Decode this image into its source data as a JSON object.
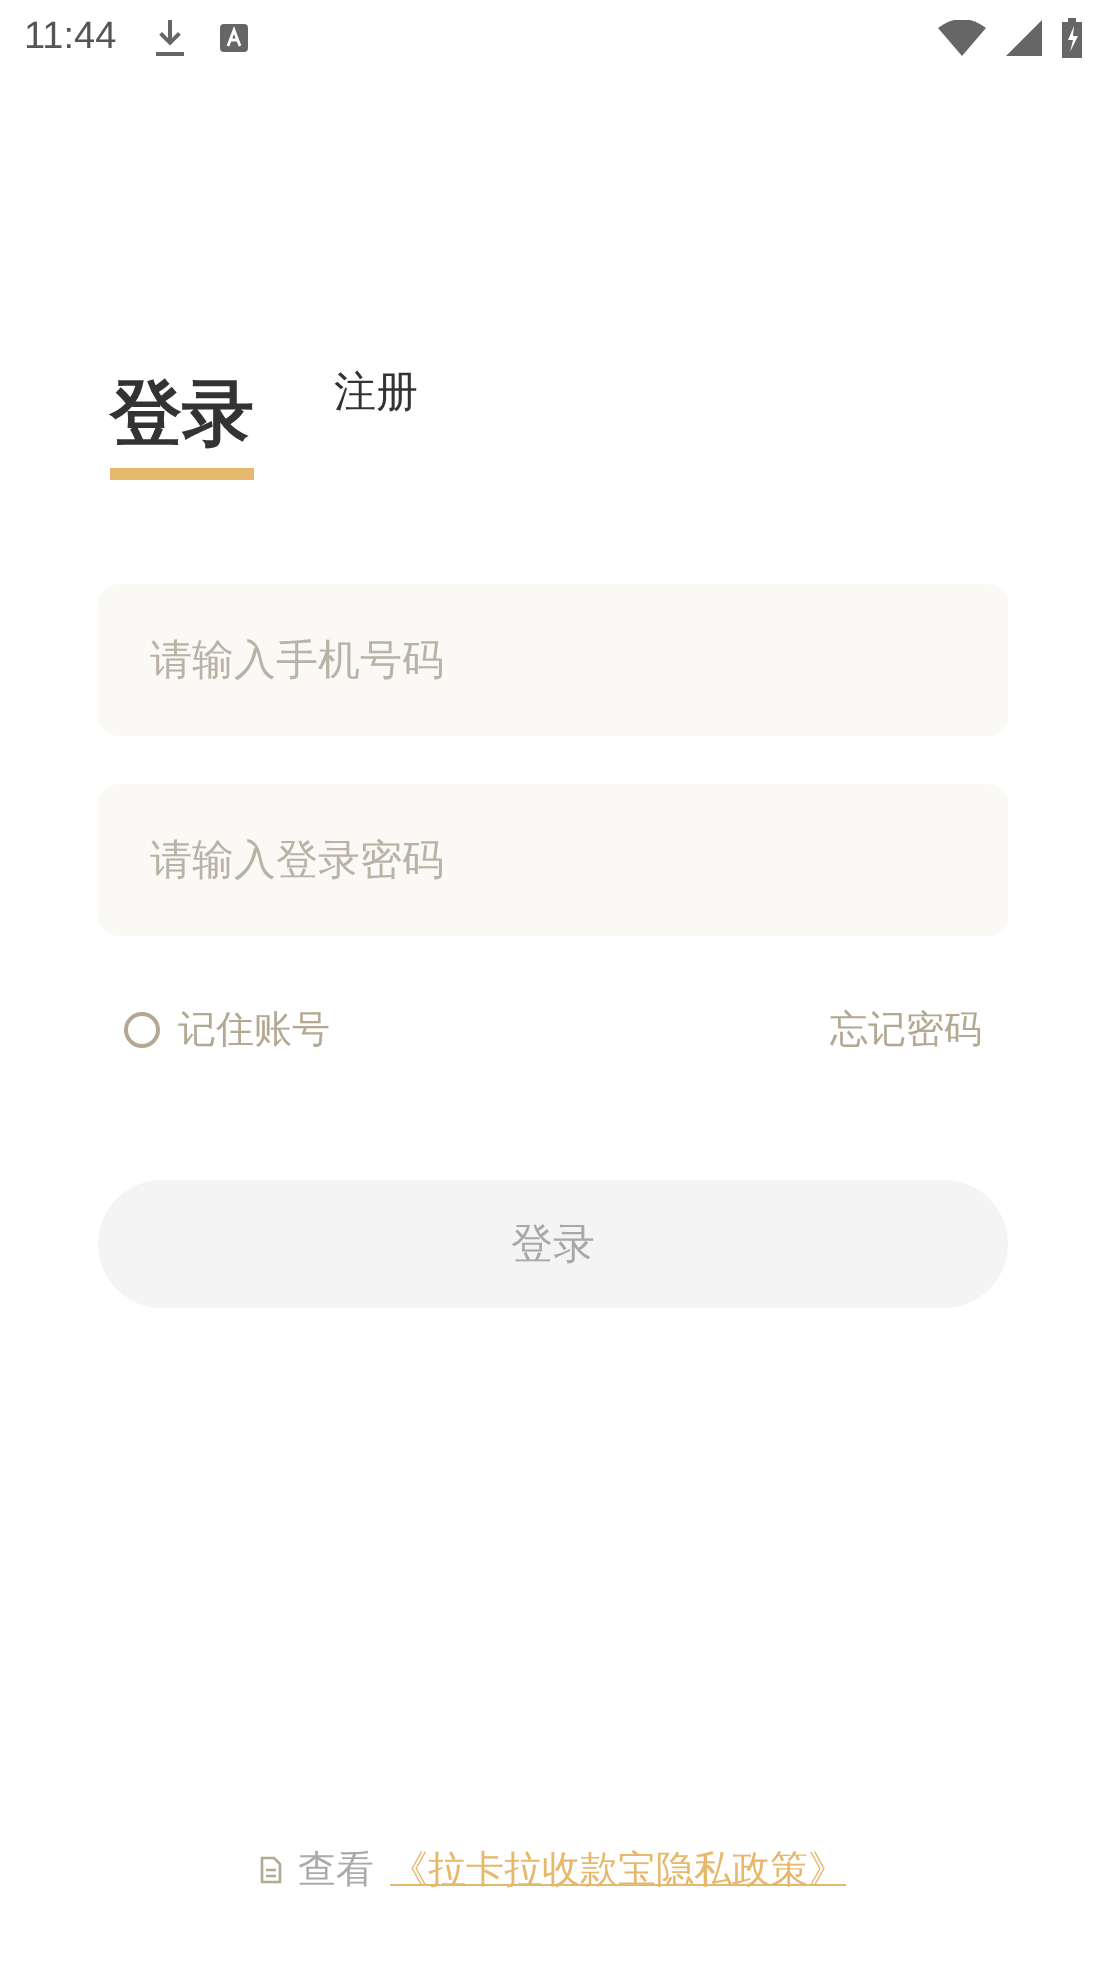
{
  "status_bar": {
    "time": "11:44"
  },
  "tabs": [
    {
      "label": "登录",
      "selected": true
    },
    {
      "label": "注册",
      "selected": false
    }
  ],
  "fields": [
    {
      "placeholder": "请输入手机号码"
    },
    {
      "placeholder": "请输入登录密码"
    }
  ],
  "remember": {
    "label": "记住账号",
    "checked": false
  },
  "forgot_link": "忘记密码",
  "login_button": {
    "label": "登录",
    "disabled": true
  },
  "footer": {
    "prefix": "查看",
    "link": "《拉卡拉收款宝隐私政策》"
  }
}
